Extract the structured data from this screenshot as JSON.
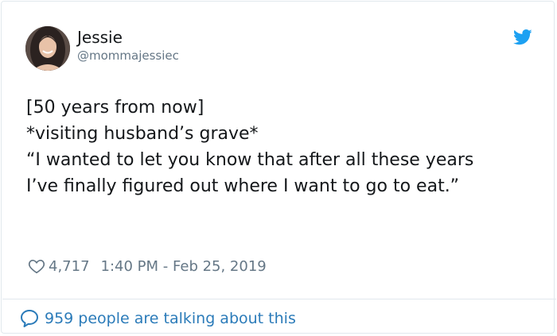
{
  "author": {
    "name": "Jessie",
    "handle": "@mommajessiec"
  },
  "tweet": {
    "lines": [
      "[50 years from now]",
      "",
      "*visiting husband’s grave*",
      "",
      "“I wanted to let you know that after all these years",
      "I’ve finally figured out where I want to go to eat.”"
    ],
    "likes": "4,717",
    "timestamp": "1:40 PM - Feb 25, 2019"
  },
  "footer": {
    "conversation": "959 people are talking about this"
  },
  "colors": {
    "twitter_blue": "#1da1f2",
    "link_blue": "#2b7bb9",
    "muted_gray": "#657786",
    "text": "#14171a"
  },
  "icons": {
    "logo": "twitter-bird-icon",
    "like": "heart-icon",
    "reply": "speech-bubble-icon"
  }
}
